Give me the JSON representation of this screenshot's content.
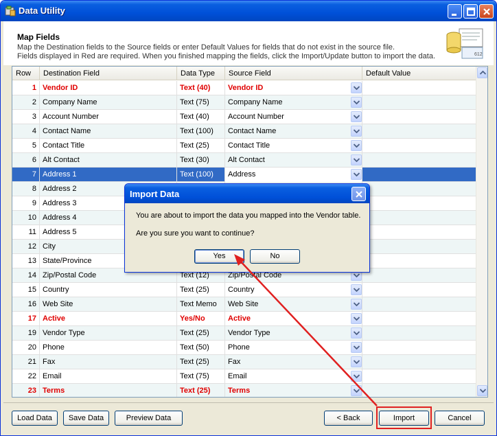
{
  "window": {
    "title": "Data Utility"
  },
  "header": {
    "title": "Map Fields",
    "line1": "Map the Destination fields to the Source fields or enter Default Values for fields that do not exist in the source file.",
    "line2": "Fields displayed in Red are required.  When you finished mapping the fields, click the Import/Update button to import the data.",
    "icon_label": "612"
  },
  "grid": {
    "columns": [
      "Row",
      "Destination Field",
      "Data Type",
      "Source Field",
      "Default Value"
    ],
    "rows": [
      {
        "num": "1",
        "dest": "Vendor ID",
        "type": "Text (40)",
        "src": "Vendor ID",
        "required": true
      },
      {
        "num": "2",
        "dest": "Company Name",
        "type": "Text (75)",
        "src": "Company Name",
        "required": false
      },
      {
        "num": "3",
        "dest": "Account Number",
        "type": "Text (40)",
        "src": "Account Number",
        "required": false
      },
      {
        "num": "4",
        "dest": "Contact Name",
        "type": "Text (100)",
        "src": "Contact Name",
        "required": false
      },
      {
        "num": "5",
        "dest": "Contact Title",
        "type": "Text (25)",
        "src": "Contact Title",
        "required": false
      },
      {
        "num": "6",
        "dest": "Alt Contact",
        "type": "Text (30)",
        "src": "Alt Contact",
        "required": false
      },
      {
        "num": "7",
        "dest": "Address 1",
        "type": "Text (100)",
        "src": "Address",
        "required": false,
        "selected": true
      },
      {
        "num": "8",
        "dest": "Address 2",
        "type": "",
        "src": "",
        "required": false
      },
      {
        "num": "9",
        "dest": "Address 3",
        "type": "",
        "src": "",
        "required": false
      },
      {
        "num": "10",
        "dest": "Address 4",
        "type": "",
        "src": "",
        "required": false
      },
      {
        "num": "11",
        "dest": "Address 5",
        "type": "",
        "src": "",
        "required": false
      },
      {
        "num": "12",
        "dest": "City",
        "type": "",
        "src": "",
        "required": false
      },
      {
        "num": "13",
        "dest": "State/Province",
        "type": "",
        "src": "",
        "required": false
      },
      {
        "num": "14",
        "dest": "Zip/Postal Code",
        "type": "Text (12)",
        "src": "Zip/Postal Code",
        "required": false
      },
      {
        "num": "15",
        "dest": "Country",
        "type": "Text (25)",
        "src": "Country",
        "required": false
      },
      {
        "num": "16",
        "dest": "Web Site",
        "type": "Text Memo",
        "src": "Web Site",
        "required": false
      },
      {
        "num": "17",
        "dest": "Active",
        "type": "Yes/No",
        "src": "Active",
        "required": true
      },
      {
        "num": "19",
        "dest": "Vendor Type",
        "type": "Text (25)",
        "src": "Vendor Type",
        "required": false
      },
      {
        "num": "20",
        "dest": "Phone",
        "type": "Text (50)",
        "src": "Phone",
        "required": false
      },
      {
        "num": "21",
        "dest": "Fax",
        "type": "Text (25)",
        "src": "Fax",
        "required": false
      },
      {
        "num": "22",
        "dest": "Email",
        "type": "Text (75)",
        "src": "Email",
        "required": false
      },
      {
        "num": "23",
        "dest": "Terms",
        "type": "Text (25)",
        "src": "Terms",
        "required": true
      }
    ]
  },
  "footer": {
    "load_data": "Load Data",
    "save_data": "Save Data",
    "preview_data": "Preview Data",
    "back": "< Back",
    "import": "Import",
    "cancel": "Cancel"
  },
  "dialog": {
    "title": "Import Data",
    "message1": "You are about to import the data you mapped into the  Vendor table.",
    "message2": "Are you sure you want to continue?",
    "yes": "Yes",
    "no": "No"
  },
  "colors": {
    "required": "#e00000",
    "selection": "#316ac5",
    "annotation": "#e02020"
  }
}
